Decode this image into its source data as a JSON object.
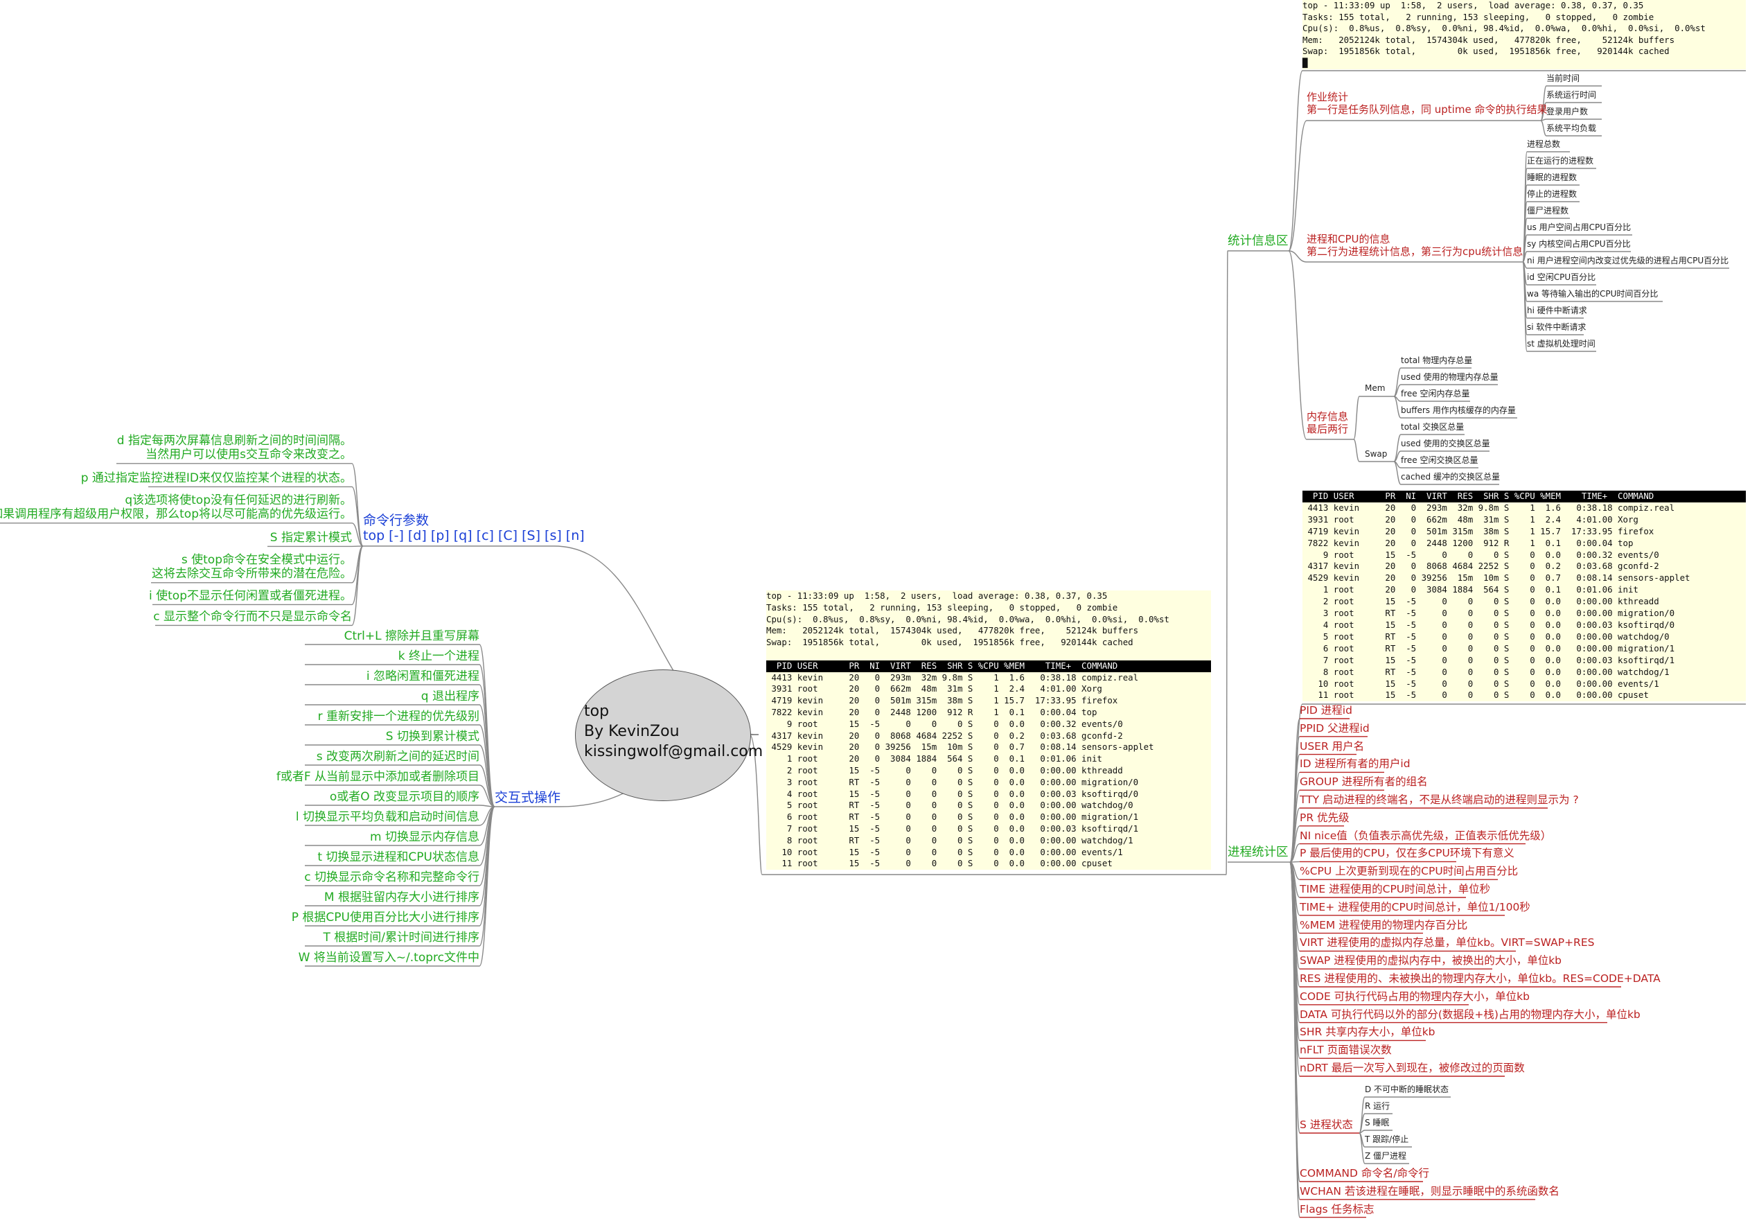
{
  "central": {
    "title": "top",
    "author": "By KevinZou",
    "email": "kissingwolf@gmail.com"
  },
  "cmdline": {
    "title": "命令行参数",
    "syntax": "top [-] [d] [p] [q] [c] [C] [S] [s] [n]",
    "items": [
      [
        "d 指定每两次屏幕信息刷新之间的时间间隔。",
        "当然用户可以使用s交互命令来改变之。"
      ],
      [
        "p 通过指定监控进程ID来仅仅监控某个进程的状态。"
      ],
      [
        "q该选项将使top没有任何延迟的进行刷新。",
        "如果调用程序有超级用户权限，那么top将以尽可能高的优先级运行。"
      ],
      [
        "S 指定累计模式"
      ],
      [
        "s 使top命令在安全模式中运行。",
        "这将去除交互命令所带来的潜在危险。"
      ],
      [
        "i 使top不显示任何闲置或者僵死进程。"
      ],
      [
        "c 显示整个命令行而不只是显示命令名"
      ]
    ]
  },
  "interactive": {
    "title": "交互式操作",
    "items": [
      "Ctrl+L 擦除并且重写屏幕",
      "k 终止一个进程",
      "i 忽略闲置和僵死进程",
      "q 退出程序",
      "r 重新安排一个进程的优先级别",
      "S 切换到累计模式",
      "s 改变两次刷新之间的延迟时间",
      "f或者F 从当前显示中添加或者删除项目",
      "o或者O 改变显示项目的顺序",
      "l 切换显示平均负载和启动时间信息",
      "m 切换显示内存信息",
      "t 切换显示进程和CPU状态信息",
      "c 切换显示命令名称和完整命令行",
      "M 根据驻留内存大小进行排序",
      "P 根据CPU使用百分比大小进行排序",
      "T 根据时间/累计时间进行排序",
      "W 将当前设置写入~/.toprc文件中"
    ]
  },
  "stats": {
    "title": "统计信息区",
    "summary_lines": [
      "top - 11:33:09 up  1:58,  2 users,  load average: 0.38, 0.37, 0.35",
      "Tasks: 155 total,   2 running, 153 sleeping,   0 stopped,   0 zombie",
      "Cpu(s):  0.8%us,  0.8%sy,  0.0%ni, 98.4%id,  0.0%wa,  0.0%hi,  0.0%si,  0.0%st",
      "Mem:   2052124k total,  1574304k used,   477820k free,    52124k buffers",
      "Swap:  1951856k total,        0k used,  1951856k free,   920144k cached"
    ],
    "job": {
      "title": [
        "作业统计",
        "第一行是任务队列信息，同 uptime 命令的执行结果"
      ],
      "items": [
        "当前时间",
        "系统运行时间",
        "登录用户数",
        "系统平均负载"
      ]
    },
    "proc_cpu": {
      "title": [
        "进程和CPU的信息",
        "第二行为进程统计信息，第三行为cpu统计信息"
      ],
      "items": [
        "进程总数",
        "正在运行的进程数",
        "睡眠的进程数",
        "停止的进程数",
        "僵尸进程数",
        "us 用户空间占用CPU百分比",
        "sy 内核空间占用CPU百分比",
        "ni 用户进程空间内改变过优先级的进程占用CPU百分比",
        "id 空闲CPU百分比",
        "wa 等待输入输出的CPU时间百分比",
        "hi 硬件中断请求",
        "si 软件中断请求",
        "st 虚拟机处理时间"
      ]
    },
    "memory": {
      "title": [
        "内存信息",
        "最后两行"
      ],
      "mem": {
        "label": "Mem",
        "items": [
          "total 物理内存总量",
          "used 使用的物理内存总量",
          "free 空闲内存总量",
          "buffers 用作内核缓存的内存量"
        ]
      },
      "swap": {
        "label": "Swap",
        "items": [
          "total 交换区总量",
          "used 使用的交换区总量",
          "free 空闲交换区总量",
          "cached 缓冲的交换区总量"
        ]
      }
    }
  },
  "process_table": {
    "header": "  PID USER      PR  NI  VIRT  RES  SHR S %CPU %MEM    TIME+  COMMAND        ",
    "rows": [
      " 4413 kevin     20   0  293m  32m 9.8m S    1  1.6   0:38.18 compiz.real",
      " 3931 root      20   0  662m  48m  31m S    1  2.4   4:01.00 Xorg",
      " 4719 kevin     20   0  501m 315m  38m S    1 15.7  17:33.95 firefox",
      " 7822 kevin     20   0  2448 1200  912 R    1  0.1   0:00.04 top",
      "    9 root      15  -5     0    0    0 S    0  0.0   0:00.32 events/0",
      " 4317 kevin     20   0  8068 4684 2252 S    0  0.2   0:03.68 gconfd-2",
      " 4529 kevin     20   0 39256  15m  10m S    0  0.7   0:08.14 sensors-applet",
      "    1 root      20   0  3084 1884  564 S    0  0.1   0:01.06 init",
      "    2 root      15  -5     0    0    0 S    0  0.0   0:00.00 kthreadd",
      "    3 root      RT  -5     0    0    0 S    0  0.0   0:00.00 migration/0",
      "    4 root      15  -5     0    0    0 S    0  0.0   0:00.03 ksoftirqd/0",
      "    5 root      RT  -5     0    0    0 S    0  0.0   0:00.00 watchdog/0",
      "    6 root      RT  -5     0    0    0 S    0  0.0   0:00.00 migration/1",
      "    7 root      15  -5     0    0    0 S    0  0.0   0:00.03 ksoftirqd/1",
      "    8 root      RT  -5     0    0    0 S    0  0.0   0:00.00 watchdog/1",
      "   10 root      15  -5     0    0    0 S    0  0.0   0:00.00 events/1",
      "   11 root      15  -5     0    0    0 S    0  0.0   0:00.00 cpuset"
    ]
  },
  "procstats": {
    "title": "进程统计区",
    "fields": [
      "PID 进程id",
      "PPID 父进程id",
      "USER 用户名",
      "ID 进程所有者的用户id",
      "GROUP 进程所有者的组名",
      "TTY 启动进程的终端名，不是从终端启动的进程则显示为 ?",
      "PR 优先级",
      "NI nice值（负值表示高优先级，正值表示低优先级）",
      "P 最后使用的CPU，仅在多CPU环境下有意义",
      "%CPU 上次更新到现在的CPU时间占用百分比",
      "TIME 进程使用的CPU时间总计，单位秒",
      "TIME+ 进程使用的CPU时间总计，单位1/100秒",
      "%MEM 进程使用的物理内存百分比",
      "VIRT 进程使用的虚拟内存总量，单位kb。VIRT=SWAP+RES",
      "SWAP 进程使用的虚拟内存中，被换出的大小，单位kb",
      "RES 进程使用的、未被换出的物理内存大小，单位kb。RES=CODE+DATA",
      "CODE 可执行代码占用的物理内存大小，单位kb",
      "DATA 可执行代码以外的部分(数据段+栈)占用的物理内存大小，单位kb",
      "SHR 共享内存大小，单位kb",
      "nFLT 页面错误次数",
      "nDRT 最后一次写入到现在，被修改过的页面数"
    ],
    "state": {
      "label": "S 进程状态",
      "items": [
        "D 不可中断的睡眠状态",
        "R 运行",
        "S 睡眠",
        "T 跟踪/停止",
        "Z 僵尸进程"
      ]
    },
    "tail": [
      "COMMAND 命令名/命令行",
      "WCHAN 若该进程在睡眠，则显示睡眠中的系统函数名",
      "Flags 任务标志"
    ]
  }
}
